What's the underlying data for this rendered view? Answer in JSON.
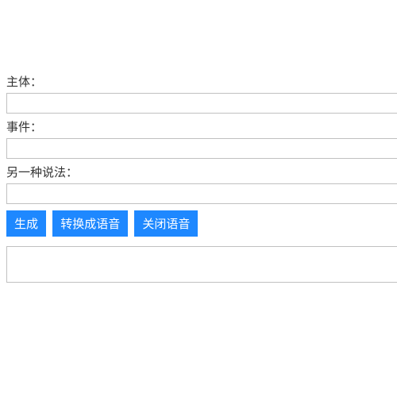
{
  "fields": {
    "subject": {
      "label": "主体：",
      "value": ""
    },
    "event": {
      "label": "事件：",
      "value": ""
    },
    "alt": {
      "label": "另一种说法：",
      "value": ""
    }
  },
  "buttons": {
    "generate": "生成",
    "to_speech": "转换成语音",
    "close_speech": "关闭语音"
  },
  "output": {
    "value": ""
  }
}
